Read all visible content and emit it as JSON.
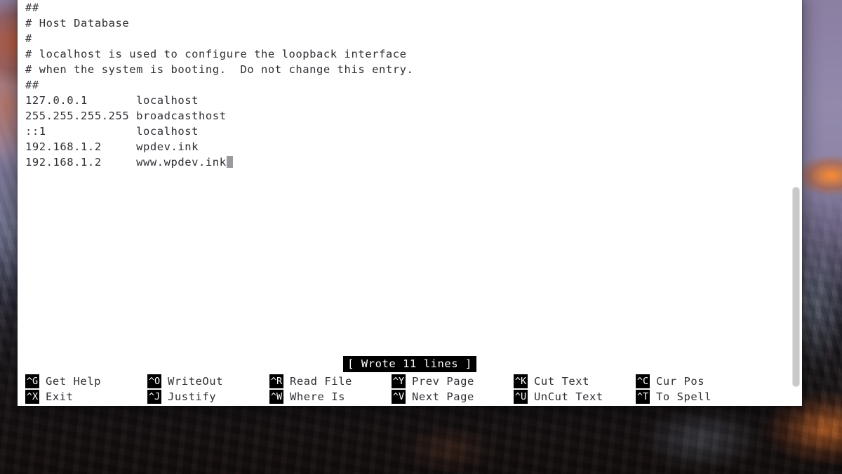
{
  "window": {
    "app": "Terminal",
    "program": "nano"
  },
  "editor": {
    "lines": [
      "##",
      "# Host Database",
      "#",
      "# localhost is used to configure the loopback interface",
      "# when the system is booting.  Do not change this entry.",
      "##",
      "127.0.0.1       localhost",
      "255.255.255.255 broadcasthost",
      "::1             localhost",
      "192.168.1.2     wpdev.ink",
      "192.168.1.2     www.wpdev.ink"
    ],
    "cursor_line_index": 10,
    "text_color": "#2f2f35",
    "background_color": "#ffffff",
    "cursor_color": "#9a9a9e"
  },
  "status": {
    "message": "[ Wrote 11 lines ]",
    "inverted": true,
    "fg": "#ffffff",
    "bg": "#000000"
  },
  "shortcuts": [
    {
      "key": "^G",
      "label": "Get Help",
      "key2": "^X",
      "label2": "Exit"
    },
    {
      "key": "^O",
      "label": "WriteOut",
      "key2": "^J",
      "label2": "Justify"
    },
    {
      "key": "^R",
      "label": "Read File",
      "key2": "^W",
      "label2": "Where Is"
    },
    {
      "key": "^Y",
      "label": "Prev Page",
      "key2": "^V",
      "label2": "Next Page"
    },
    {
      "key": "^K",
      "label": "Cut Text",
      "key2": "^U",
      "label2": "UnCut Text"
    },
    {
      "key": "^C",
      "label": "Cur Pos",
      "key2": "^T",
      "label2": "To Spell"
    }
  ],
  "scrollbar": {
    "thumb_color": "#c9c9c9"
  },
  "desktop": {
    "wallpaper_name": "mountain-dawn-wallpaper",
    "sky_color": "#8b7fa2",
    "rock_color": "#1c120e",
    "sunlit_color": "#e0782d"
  }
}
